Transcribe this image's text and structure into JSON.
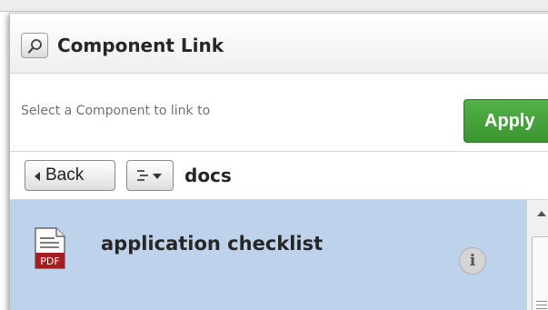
{
  "dialog": {
    "title": "Component Link",
    "search_icon": "magnifier-icon"
  },
  "selector": {
    "label": "Select a Component to link to",
    "apply_label": "Apply",
    "apply_color": "#48a43d"
  },
  "navigation": {
    "back_label": "Back",
    "sort_icon": "sort-menu-icon",
    "current_folder": "docs"
  },
  "list": {
    "items": [
      {
        "title": "application checklist",
        "file_type": "PDF",
        "icon": "pdf-file-icon",
        "info_icon": "info-icon",
        "selected": true,
        "highlight_color": "#bfd2ec"
      }
    ]
  }
}
